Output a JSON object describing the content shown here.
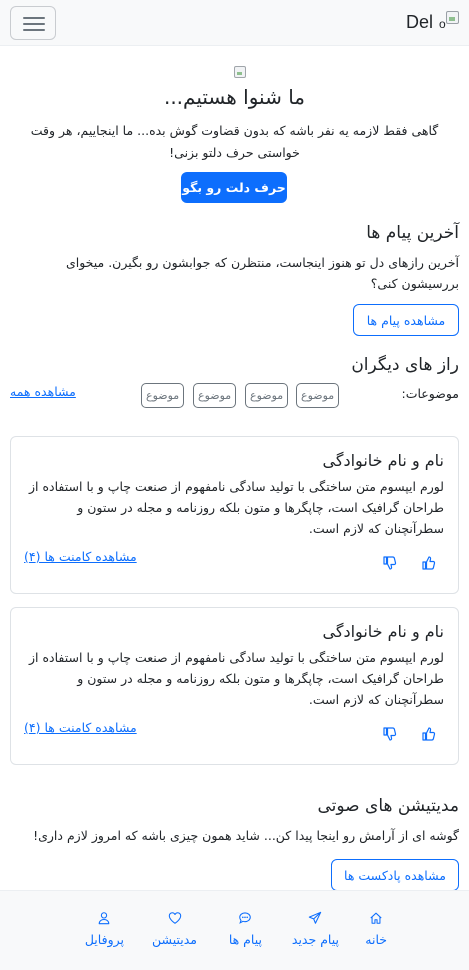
{
  "navbar": {
    "brand": "Del"
  },
  "hero": {
    "title": "ما شنوا هستیم...",
    "text": "گاهی فقط لازمه یه نفر باشه که بدون قضاوت گوش بده... ما اینجاییم، هر وقت خواستی حرف دلتو بزنی!",
    "button": "حرف دلت رو بگو"
  },
  "latest_messages": {
    "title": "آخرین پیام ها",
    "text": "آخرین رازهای دل تو هنوز اینجاست، منتظرن که جوابشون رو بگیرن. میخوای بررسیشون کنی؟",
    "button": "مشاهده پیام ها"
  },
  "secrets": {
    "title": "راز های دیگران",
    "topics_label": "موضوعات:",
    "tags": [
      "موضوع",
      "موضوع",
      "موضوع",
      "موضوع"
    ],
    "see_all": "مشاهده همه",
    "cards": [
      {
        "title": "نام و نام خانوادگی",
        "text": "لورم ایپسوم متن ساختگی با تولید سادگی نامفهوم از صنعت چاپ و با استفاده از طراحان گرافیک است، چاپگرها و متون بلکه روزنامه و مجله در ستون و سطرآنچنان که لازم است.",
        "comments_link": "مشاهده کامنت ها (۴)"
      },
      {
        "title": "نام و نام خانوادگی",
        "text": "لورم ایپسوم متن ساختگی با تولید سادگی نامفهوم از صنعت چاپ و با استفاده از طراحان گرافیک است، چاپگرها و متون بلکه روزنامه و مجله در ستون و سطرآنچنان که لازم است.",
        "comments_link": "مشاهده کامنت ها (۴)"
      }
    ]
  },
  "meditation": {
    "title": "مدیتیشن های صوتی",
    "text": "گوشه ای از آرامش رو اینجا پیدا کن... شاید همون چیزی باشه که امروز لازم داری!",
    "button": "مشاهده پادکست ها"
  },
  "bottom_nav": [
    {
      "label": "خانه",
      "icon": "home-icon"
    },
    {
      "label": "پیام جدید",
      "icon": "send-icon"
    },
    {
      "label": "پیام ها",
      "icon": "chat-icon"
    },
    {
      "label": "مدیتیشن",
      "icon": "heart-icon"
    },
    {
      "label": "پروفایل",
      "icon": "person-icon"
    }
  ],
  "colors": {
    "primary": "#0d6efd",
    "text": "#212529",
    "muted": "#6c757d",
    "navbar_bg": "#f8f9fa"
  }
}
